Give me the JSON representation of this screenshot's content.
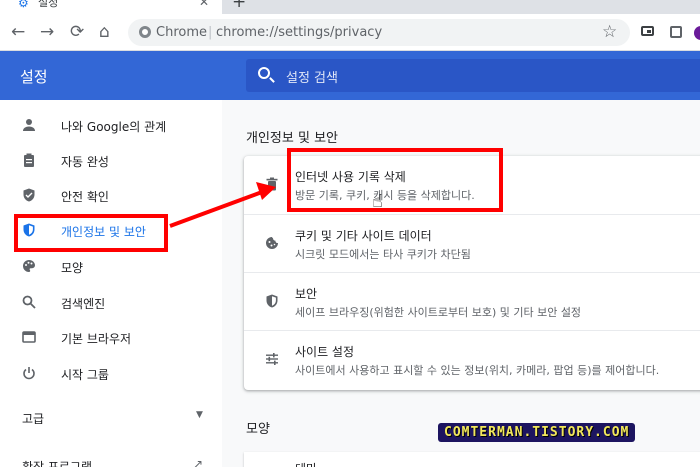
{
  "browser": {
    "tab": {
      "title": "설정",
      "close": "✕"
    },
    "new_tab": "+",
    "omnibox": {
      "site_label": "Chrome",
      "separator": "|",
      "url": "chrome://settings/privacy"
    },
    "nav": {
      "back": "←",
      "forward": "→",
      "reload": "⟳",
      "home": "⌂",
      "star": "☆"
    }
  },
  "settings_header": {
    "title": "설정",
    "search_placeholder": "설정 검색"
  },
  "sidebar": {
    "items": [
      {
        "label": "나와 Google의 관계",
        "icon": "person-icon"
      },
      {
        "label": "자동 완성",
        "icon": "clipboard-icon"
      },
      {
        "label": "안전 확인",
        "icon": "shield-check-icon"
      },
      {
        "label": "개인정보 및 보안",
        "icon": "shield-icon",
        "active": true
      },
      {
        "label": "모양",
        "icon": "palette-icon"
      },
      {
        "label": "검색엔진",
        "icon": "search-icon"
      },
      {
        "label": "기본 브라우저",
        "icon": "browser-icon"
      },
      {
        "label": "시작 그룹",
        "icon": "power-icon"
      }
    ],
    "advanced": "고급",
    "extensions": "확장 프로그램"
  },
  "main": {
    "section_title": "개인정보 및 보안",
    "rows": [
      {
        "title": "인터넷 사용 기록 삭제",
        "desc": "방문 기록, 쿠키, 캐시 등을 삭제합니다.",
        "icon": "trash-icon"
      },
      {
        "title": "쿠키 및 기타 사이트 데이터",
        "desc": "시크릿 모드에서는 타사 쿠키가 차단됨",
        "icon": "cookie-icon"
      },
      {
        "title": "보안",
        "desc": "세이프 브라우징(위험한 사이트로부터 보호) 및 기타 보안 설정",
        "icon": "shield-icon"
      },
      {
        "title": "사이트 설정",
        "desc": "사이트에서 사용하고 표시할 수 있는 정보(위치, 카메라, 팝업 등)를 제어합니다.",
        "icon": "tune-icon"
      }
    ],
    "section2_title": "모양",
    "section2_first_row": "테마"
  },
  "watermark": "COMTERMAN.TISTORY.COM",
  "colors": {
    "accent": "#1a73e8",
    "header": "#3367d6",
    "annotation": "#ff0000"
  }
}
